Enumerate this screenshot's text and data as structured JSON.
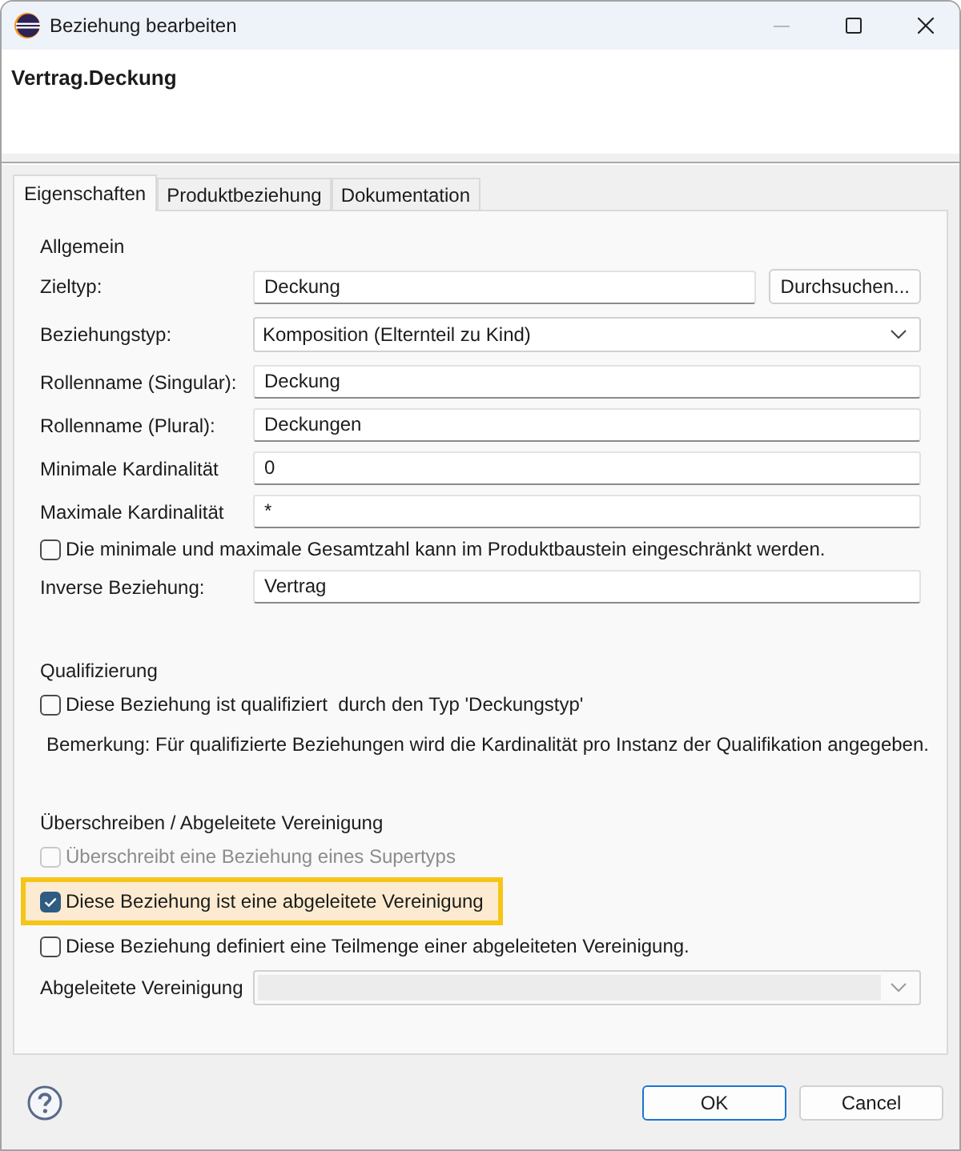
{
  "window": {
    "title": "Beziehung bearbeiten"
  },
  "header": {
    "title": "Vertrag.Deckung"
  },
  "tabs": [
    {
      "label": "Eigenschaften",
      "selected": true
    },
    {
      "label": "Produktbeziehung",
      "selected": false
    },
    {
      "label": "Dokumentation",
      "selected": false
    }
  ],
  "sections": [
    {
      "title": "Allgemein",
      "rows": [
        {
          "kind": "text",
          "label": "Zieltyp:",
          "value": "Deckung",
          "button": "Durchsuchen...",
          "disabled": false,
          "highlighted": false
        },
        {
          "kind": "combo",
          "label": "Beziehungstyp:",
          "value": "Komposition (Elternteil zu Kind)",
          "disabled": false,
          "highlighted": false
        },
        {
          "kind": "text",
          "label": "Rollenname (Singular):",
          "value": "Deckung",
          "disabled": false,
          "highlighted": false
        },
        {
          "kind": "text",
          "label": "Rollenname (Plural):",
          "value": "Deckungen",
          "disabled": false,
          "highlighted": false
        },
        {
          "kind": "text",
          "label": "Minimale Kardinalität",
          "value": "0",
          "disabled": false,
          "highlighted": false
        },
        {
          "kind": "text",
          "label": "Maximale Kardinalität",
          "value": "*",
          "disabled": false,
          "highlighted": false
        },
        {
          "kind": "checkbox",
          "label": "Die minimale und maximale Gesamtzahl kann im Produktbaustein eingeschränkt werden.",
          "checked": false,
          "disabled": false,
          "highlighted": false
        },
        {
          "kind": "text",
          "label": "Inverse Beziehung:",
          "value": "Vertrag",
          "disabled": false,
          "highlighted": false
        }
      ]
    },
    {
      "title": "Qualifizierung",
      "rows": [
        {
          "kind": "checkbox",
          "label": "Diese Beziehung ist qualifiziert  durch den Typ 'Deckungstyp'",
          "checked": false,
          "disabled": false,
          "highlighted": false
        },
        {
          "kind": "note",
          "label": "Bemerkung: Für qualifizierte Beziehungen wird die Kardinalität pro Instanz der Qualifikation angegeben.",
          "disabled": false,
          "highlighted": false
        }
      ]
    },
    {
      "title": "Überschreiben / Abgeleitete Vereinigung",
      "rows": [
        {
          "kind": "checkbox",
          "label": "Überschreibt eine Beziehung eines Supertyps",
          "checked": false,
          "disabled": true,
          "highlighted": false
        },
        {
          "kind": "checkbox",
          "label": "Diese Beziehung ist eine abgeleitete Vereinigung",
          "checked": true,
          "disabled": false,
          "highlighted": true
        },
        {
          "kind": "checkbox",
          "label": "Diese Beziehung definiert eine Teilmenge einer abgeleiteten Vereinigung.",
          "checked": false,
          "disabled": false,
          "highlighted": false
        },
        {
          "kind": "combo",
          "label": "Abgeleitete Vereinigung",
          "disabled": true,
          "highlighted": false
        }
      ]
    }
  ],
  "buttons": [
    {
      "label": "OK",
      "default": true
    },
    {
      "label": "Cancel",
      "default": false
    }
  ]
}
